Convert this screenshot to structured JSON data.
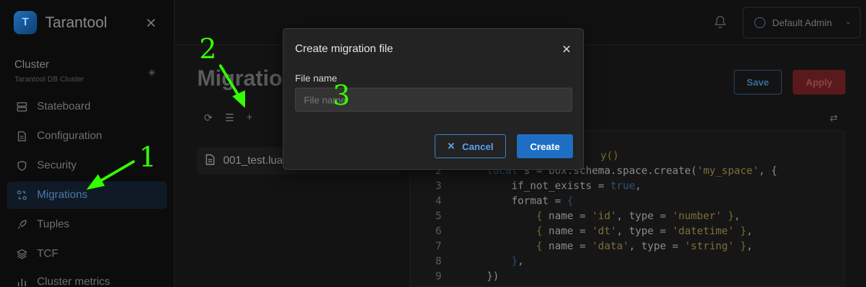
{
  "app": {
    "name": "Tarantool"
  },
  "cluster": {
    "title": "Cluster",
    "subtitle": "Tarantool DB Cluster"
  },
  "sidebar": {
    "items": [
      {
        "label": "Stateboard",
        "icon": "stateboard-icon",
        "active": false
      },
      {
        "label": "Configuration",
        "icon": "file-icon",
        "active": false
      },
      {
        "label": "Security",
        "icon": "shield-icon",
        "active": false
      },
      {
        "label": "Migrations",
        "icon": "migrations-icon",
        "active": true
      },
      {
        "label": "Tuples",
        "icon": "rocket-icon",
        "active": false
      },
      {
        "label": "TCF",
        "icon": "layers-icon",
        "active": false
      },
      {
        "label": "Cluster metrics",
        "icon": "metrics-icon",
        "active": false
      }
    ]
  },
  "header": {
    "user": "Default Admin"
  },
  "main": {
    "title": "Migratio",
    "file": "001_test.lua",
    "save_label": "Save",
    "apply_label": "Apply"
  },
  "editor": {
    "line_numbers": [
      "2",
      "3",
      "4",
      "5",
      "6",
      "7",
      "8",
      "9"
    ]
  },
  "modal": {
    "title": "Create migration file",
    "field_label": "File name",
    "placeholder": "File name",
    "cancel_label": "Cancel",
    "create_label": "Create"
  },
  "annotations": {
    "one": "1",
    "two": "2",
    "three": "3",
    "color": "#33ff00"
  }
}
